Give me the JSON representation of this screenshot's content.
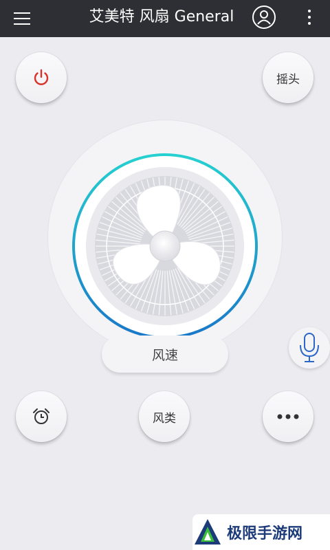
{
  "appbar": {
    "title": "艾美特 风扇 General",
    "icons": [
      "menu-icon",
      "account-icon",
      "more-vert-icon"
    ]
  },
  "controls": {
    "swing_label": "摇头",
    "speed_label": "风速",
    "mode_label": "风类",
    "power_icon": "power-icon",
    "timer_icon": "alarm-clock-icon",
    "more_icon": "more-horiz-icon",
    "mic_icon": "microphone-icon"
  },
  "colors": {
    "appbar": "#2e2f35",
    "power": "#d9302a",
    "ring_start": "#26d0d0",
    "ring_end": "#1a78c8",
    "mic": "#2b66c9"
  },
  "watermark": {
    "text": "极限手游网"
  }
}
